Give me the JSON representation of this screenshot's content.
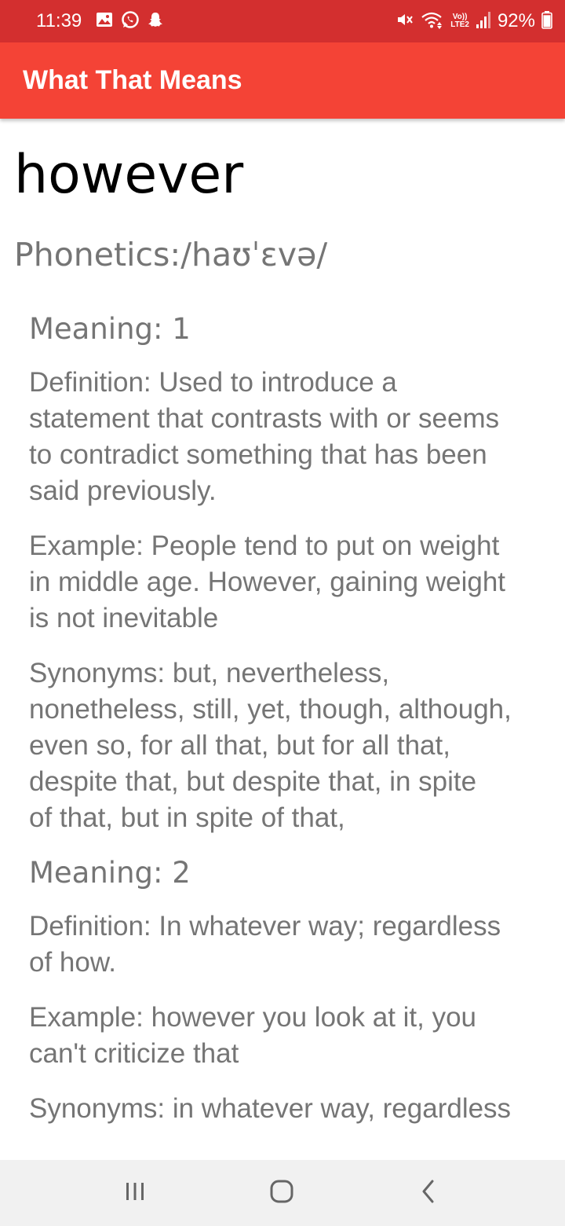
{
  "status_bar": {
    "time": "11:39",
    "battery_percent": "92%",
    "network_label_top": "Vo))",
    "network_label_bottom": "LTE2",
    "left_icons": [
      "gallery-icon",
      "whatsapp-icon",
      "snapchat-icon"
    ],
    "right_icons": [
      "mute-icon",
      "wifi-icon",
      "signal-icon",
      "battery-icon"
    ],
    "battery_level": 0.92
  },
  "app_bar": {
    "title": "What That Means",
    "color": "#f44336"
  },
  "entry": {
    "word": "however",
    "phonetics_label": "Phonetics:",
    "phonetics_value": "/haʊˈɛvə/",
    "meanings": [
      {
        "heading": "Meaning: 1",
        "definition": [
          "Definition: Used to introduce a",
          "statement that contrasts with or seems",
          "to contradict something that has been",
          "said previously."
        ],
        "example": [
          "Example: People tend to put on weight",
          "in middle age. However, gaining weight",
          "is not inevitable"
        ],
        "synonyms": [
          "Synonyms: but, nevertheless,",
          "nonetheless, still, yet, though, although,",
          "even so, for all that, but for all that,",
          "despite that, but despite that, in spite",
          "of that, but in spite of that,"
        ]
      },
      {
        "heading": "Meaning: 2",
        "definition": [
          "Definition: In whatever way; regardless",
          "of how."
        ],
        "example": [
          "Example: however you look at it, you",
          "can't criticize that"
        ],
        "synonyms": [
          "Synonyms: in whatever way, regardless"
        ]
      }
    ]
  },
  "nav_bar": {
    "buttons": [
      "recents-icon",
      "home-icon",
      "back-icon"
    ]
  }
}
